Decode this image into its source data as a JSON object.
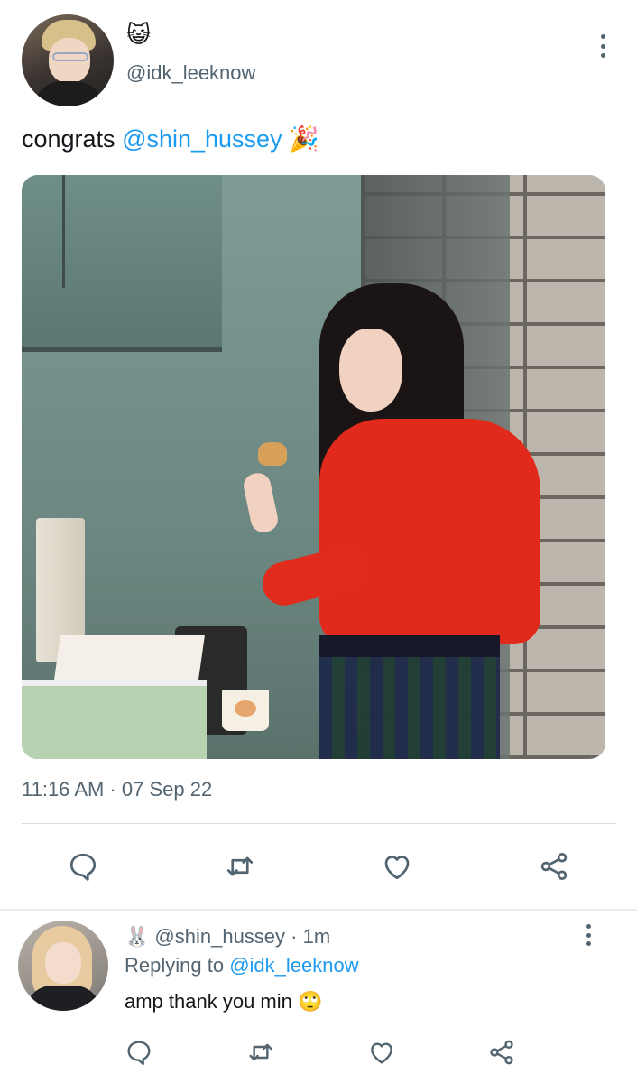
{
  "tweet": {
    "display_emoji": "😺",
    "handle": "@idk_leeknow",
    "text_prefix": "congrats ",
    "text_mention": "@shin_hussey",
    "text_emoji": " 🎉",
    "timestamp": "11:16 AM · 07 Sep 22"
  },
  "reply": {
    "display_emoji": "🐰",
    "handle_time": "@shin_hussey · 1m",
    "replying_prefix": "Replying to ",
    "replying_mention": "@idk_leeknow",
    "text": "amp thank you min 🙄"
  },
  "icons": {
    "reply": "comment-icon",
    "retweet": "retweet-icon",
    "like": "heart-icon",
    "share": "share-icon",
    "more": "more-vertical-icon"
  },
  "colors": {
    "accent": "#1d9bf0",
    "secondary_text": "#536471",
    "divider": "#d3dbe0"
  }
}
